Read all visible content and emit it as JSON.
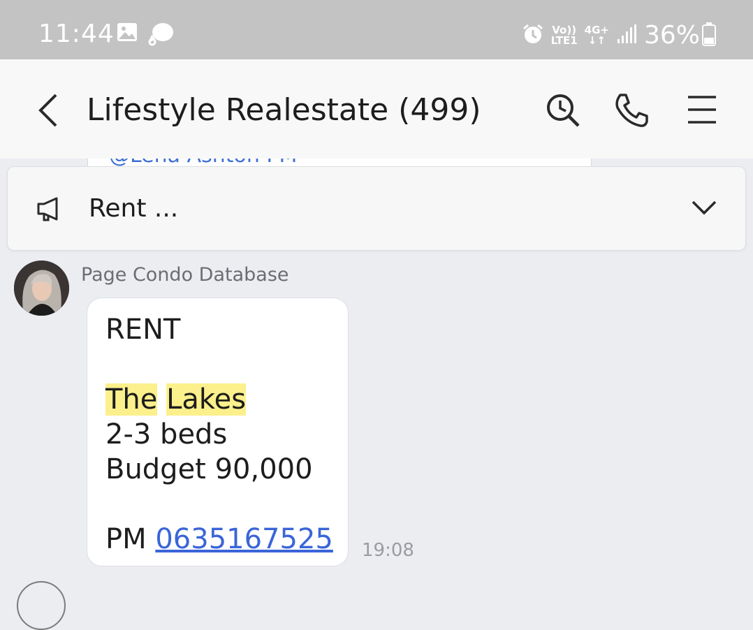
{
  "status_bar": {
    "time": "11:44",
    "network_top": "Vo))",
    "network_bottom": "LTE1",
    "data_top": "4G+",
    "data_bottom": "↓↑",
    "battery": "36%"
  },
  "header": {
    "title": "Lifestyle Realestate (499)"
  },
  "peek_message": {
    "text": "@Lena Ashton    PM"
  },
  "notice": {
    "text": "Rent ..."
  },
  "message": {
    "sender": "Page Condo Database",
    "line1": "RENT",
    "highlight1": "The",
    "highlight2": "Lakes",
    "line3": "2-3 beds",
    "line4": "Budget 90,000",
    "pm_prefix": "PM ",
    "phone": "0635167525",
    "time": "19:08"
  },
  "colors": {
    "status_bar": "#c3c3c3",
    "header_bg": "#f8f8f8",
    "chat_bg": "#ebedf1",
    "highlight": "#fbf08b",
    "link": "#3a65d8"
  }
}
